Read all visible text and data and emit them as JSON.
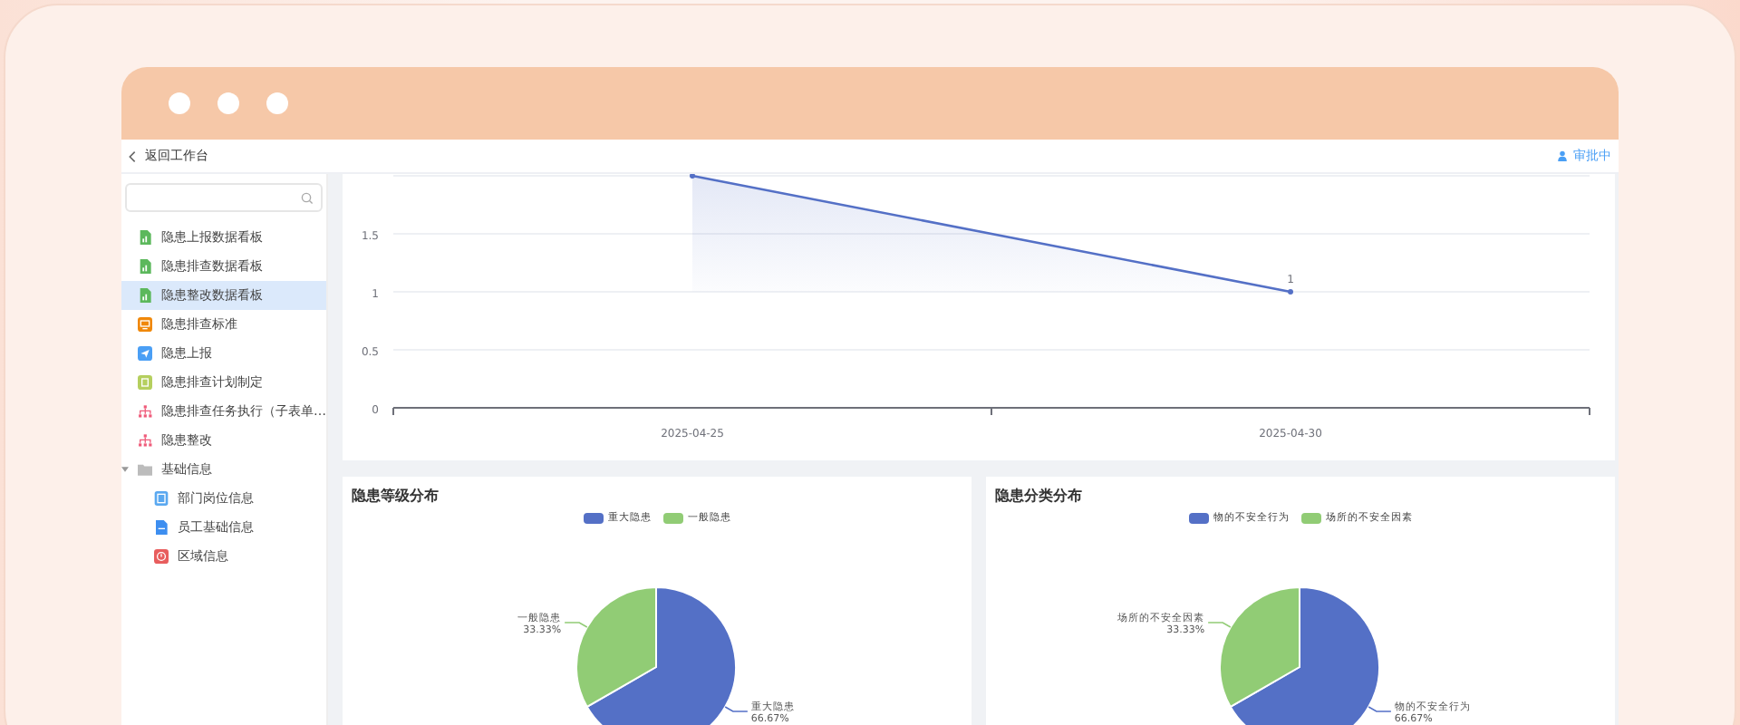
{
  "topbar": {
    "back_label": "返回工作台",
    "status": "审批中"
  },
  "sidebar": {
    "items": [
      {
        "label": "隐患上报数据看板",
        "kind": "report",
        "selected": false
      },
      {
        "label": "隐患排查数据看板",
        "kind": "report",
        "selected": false
      },
      {
        "label": "隐患整改数据看板",
        "kind": "report",
        "selected": true
      },
      {
        "label": "隐患排查标准",
        "kind": "standard",
        "selected": false
      },
      {
        "label": "隐患上报",
        "kind": "upload",
        "selected": false
      },
      {
        "label": "隐患排查计划制定",
        "kind": "plan",
        "selected": false
      },
      {
        "label": "隐患排查任务执行（子表单…",
        "kind": "task",
        "selected": false
      },
      {
        "label": "隐患整改",
        "kind": "task",
        "selected": false
      },
      {
        "label": "基础信息",
        "kind": "folder",
        "selected": false,
        "expanded": true,
        "children": [
          {
            "label": "部门岗位信息",
            "kind": "dept",
            "selected": false
          },
          {
            "label": "员工基础信息",
            "kind": "staff",
            "selected": false
          },
          {
            "label": "区域信息",
            "kind": "area",
            "selected": false
          }
        ]
      }
    ]
  },
  "trend_card": {
    "chart_data": {
      "type": "area",
      "categories": [
        "2025-04-25",
        "2025-04-30"
      ],
      "values": [
        2,
        1
      ],
      "ylim": [
        0,
        2
      ],
      "yticks": [
        0,
        0.5,
        1,
        1.5
      ],
      "grid": true,
      "value_labels": [
        null,
        "1"
      ]
    }
  },
  "level_card": {
    "title": "隐患等级分布",
    "chart_data": {
      "type": "pie",
      "categories": [
        "重大隐患",
        "一般隐患"
      ],
      "values": [
        66.67,
        33.33
      ],
      "value_labels": [
        "66.67%",
        "33.33%"
      ]
    }
  },
  "category_card": {
    "title": "隐患分类分布",
    "chart_data": {
      "type": "pie",
      "categories": [
        "物的不安全行为",
        "场所的不安全因素"
      ],
      "values": [
        66.67,
        33.33
      ],
      "value_labels": [
        "66.67%",
        "33.33%"
      ]
    }
  }
}
